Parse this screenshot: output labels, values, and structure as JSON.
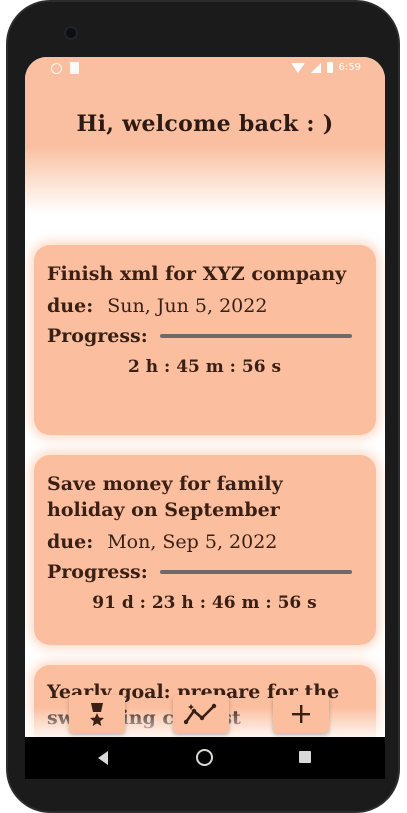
{
  "status_bar": {
    "time": "6:59"
  },
  "header": {
    "greeting": "Hi, welcome back  : )"
  },
  "tasks": [
    {
      "title": "Finish xml for XYZ company",
      "due_label": "due:",
      "due_value": "Sun, Jun 5, 2022",
      "progress_label": "Progress:",
      "progress": 0,
      "countdown": "2 h : 45 m :  56 s"
    },
    {
      "title": "Save money for family holiday on September",
      "due_label": "due:",
      "due_value": "Mon, Sep 5, 2022",
      "progress_label": "Progress:",
      "progress": 0,
      "countdown": "91 d : 23 h : 46 m :  56 s"
    },
    {
      "title": "Yearly goal: prepare for the swimming contest"
    }
  ],
  "bottom_actions": [
    {
      "icon": "medal-icon",
      "label": "achievements"
    },
    {
      "icon": "trend-chart-icon",
      "label": "statistics"
    },
    {
      "icon": "plus-icon",
      "label": "add task"
    }
  ],
  "colors": {
    "accent": "#fbbf9f",
    "text": "#3a1f15",
    "progress_track": "#6f6a68"
  }
}
